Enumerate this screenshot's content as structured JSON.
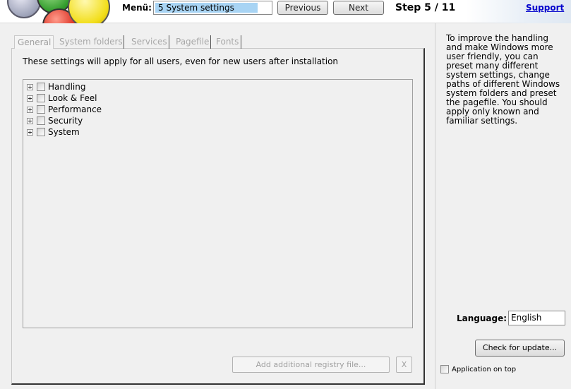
{
  "header": {
    "menu_label": "Menü:",
    "menu_selected": "5 System settings",
    "previous_label": "Previous",
    "next_label": "Next",
    "step_label": "Step 5 / 11",
    "support_label": "Support"
  },
  "tabs": [
    {
      "label": "General",
      "active": true
    },
    {
      "label": "System folders",
      "active": false
    },
    {
      "label": "Services",
      "active": false
    },
    {
      "label": "Pagefile",
      "active": false
    },
    {
      "label": "Fonts",
      "active": false
    }
  ],
  "main": {
    "intro_text": "These settings will apply for all users, even for new users after installation",
    "tree_items": [
      {
        "label": "Handling",
        "checked": false
      },
      {
        "label": "Look & Feel",
        "checked": false
      },
      {
        "label": "Performance",
        "checked": false
      },
      {
        "label": "Security",
        "checked": false
      },
      {
        "label": "System",
        "checked": false
      }
    ],
    "add_registry_label": "Add additional registry file...",
    "remove_label": "X"
  },
  "sidebar": {
    "help_text": "To improve the handling and make Windows more user friendly, you can preset many different system settings, change paths of different Windows system folders and preset the pagefile. You should apply only known and familiar settings.",
    "language_label": "Language:",
    "language_value": "English",
    "update_label": "Check for update...",
    "ontop_label": "Application on top",
    "ontop_checked": false
  }
}
